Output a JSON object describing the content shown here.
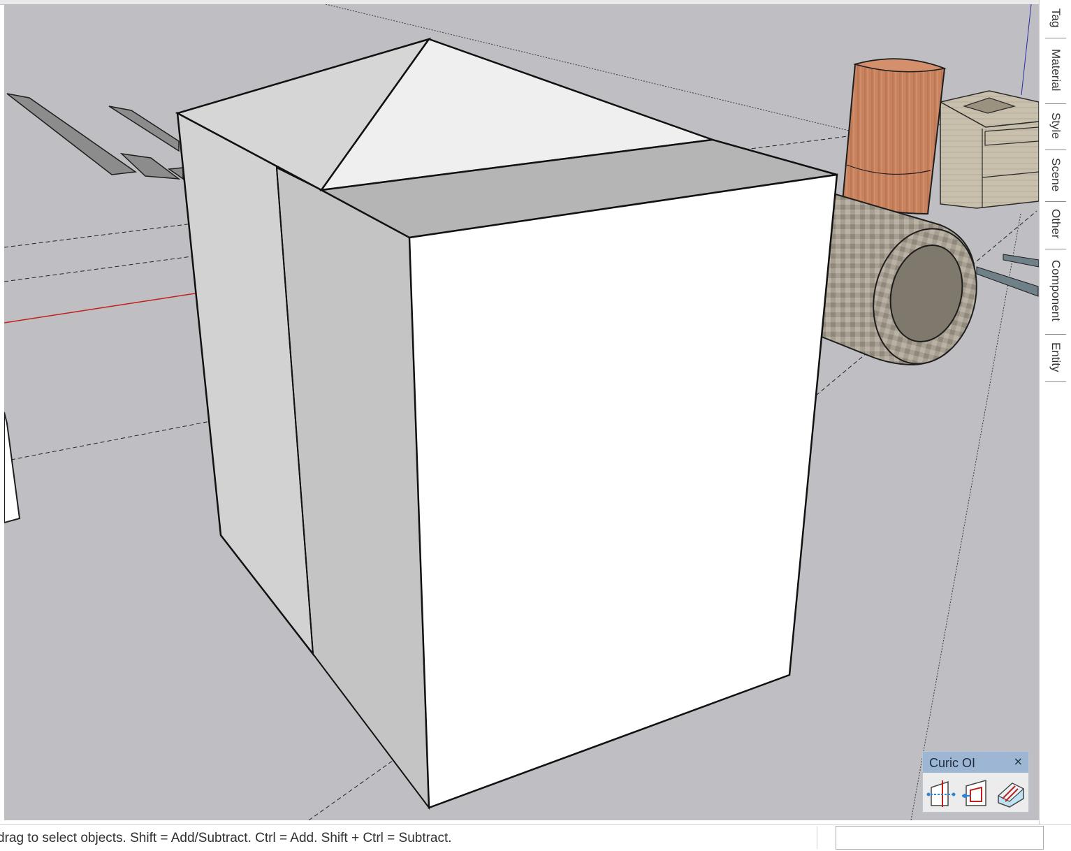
{
  "tray": {
    "tabs": [
      {
        "label": "Tag"
      },
      {
        "label": "Material"
      },
      {
        "label": "Style"
      },
      {
        "label": "Scene"
      },
      {
        "label": "Other"
      },
      {
        "label": "Component"
      },
      {
        "label": "Entity"
      }
    ]
  },
  "status": {
    "hint": "drag to select objects. Shift = Add/Subtract. Ctrl = Add. Shift + Ctrl = Subtract.",
    "measurements_value": ""
  },
  "curic_panel": {
    "title": "Curic OI",
    "close_glyph": "×",
    "buttons": [
      {
        "icon": "section-line-icon"
      },
      {
        "icon": "offset-face-icon"
      },
      {
        "icon": "solid-box-icon"
      }
    ]
  },
  "colors": {
    "viewport_background": "#bfbfc3",
    "red_axis": "#c0201a",
    "box_front_face": "#ffffff",
    "cylinder": "#c9825e",
    "pipe": "#a69e90",
    "panel_title_bar": "#9db6d3"
  }
}
